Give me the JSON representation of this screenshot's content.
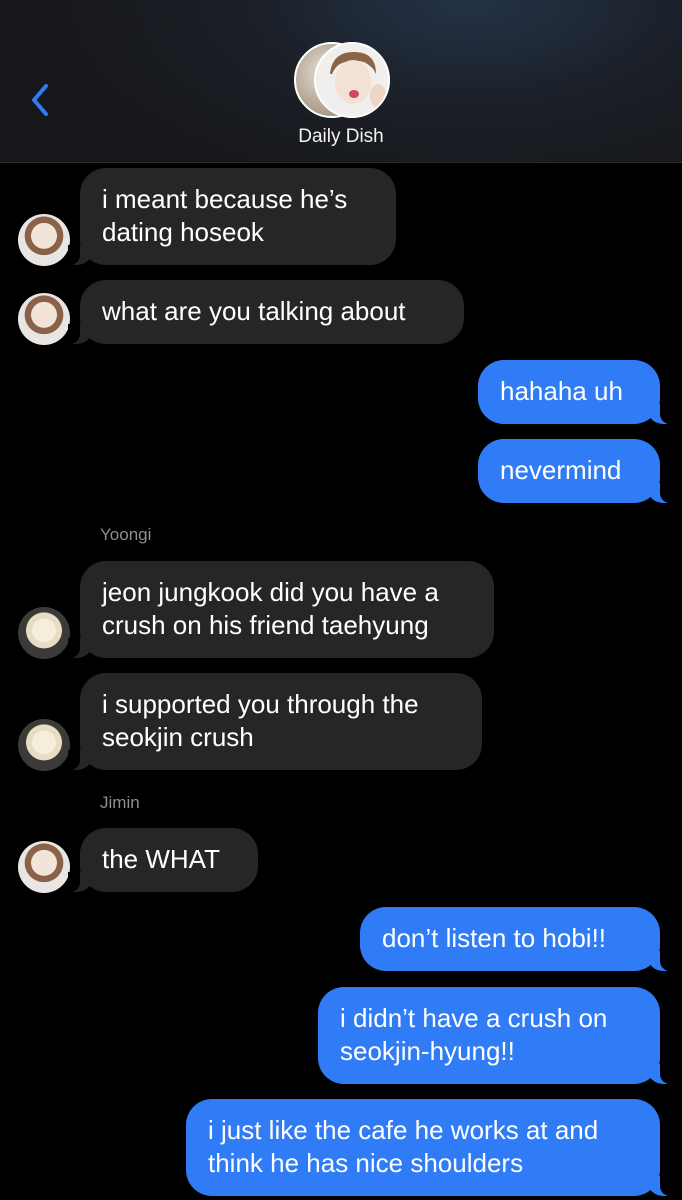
{
  "header": {
    "group_name": "Daily Dish",
    "back_icon": "chevron-left-icon",
    "accent_color": "#2f7cf6"
  },
  "messages": [
    {
      "side": "in",
      "text": "i meant because he’s\ndating hoseok",
      "avatar": "jimin"
    },
    {
      "side": "in",
      "text": "what are you talking about",
      "avatar": "jimin"
    },
    {
      "side": "out",
      "text": "hahaha uh"
    },
    {
      "side": "out",
      "text": "nevermind"
    },
    {
      "sender": "Yoongi"
    },
    {
      "side": "in",
      "text": "jeon jungkook did you have a\ncrush on his friend taehyung",
      "avatar": "yoongi"
    },
    {
      "side": "in",
      "text": "i supported you through the\nseokjin crush",
      "avatar": "yoongi"
    },
    {
      "sender": "Jimin"
    },
    {
      "side": "in",
      "text": "the WHAT",
      "avatar": "jimin"
    },
    {
      "side": "out",
      "text": "don’t listen to hobi!!"
    },
    {
      "side": "out",
      "text": "i didn’t have a crush on\nseokjin-hyung!!"
    },
    {
      "side": "out",
      "text": "i just like the cafe he works at and\nthink he has nice shoulders"
    }
  ]
}
